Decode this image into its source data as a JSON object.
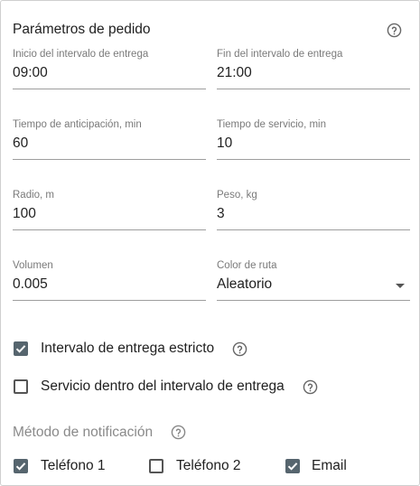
{
  "panel": {
    "title": "Parámetros de pedido",
    "help_icon": "help-circle-icon"
  },
  "fields": {
    "delivery_start": {
      "label": "Inicio del intervalo de entrega",
      "value": "09:00"
    },
    "delivery_end": {
      "label": "Fin del intervalo de entrega",
      "value": "21:00"
    },
    "lead_time": {
      "label": "Tiempo de anticipación, min",
      "value": "60"
    },
    "service_time": {
      "label": "Tiempo de servicio, min",
      "value": "10"
    },
    "radius": {
      "label": "Radio, m",
      "value": "100"
    },
    "weight": {
      "label": "Peso, kg",
      "value": "3"
    },
    "volume": {
      "label": "Volumen",
      "value": "0.005"
    },
    "route_color": {
      "label": "Color de ruta",
      "value": "Aleatorio"
    }
  },
  "options": {
    "strict_interval": {
      "label": "Intervalo de entrega estricto",
      "checked": true
    },
    "service_in_interval": {
      "label": "Servicio dentro del intervalo de entrega",
      "checked": false
    }
  },
  "notification": {
    "label": "Método de notificación",
    "phone1": {
      "label": "Teléfono 1",
      "checked": true
    },
    "phone2": {
      "label": "Teléfono 2",
      "checked": false
    },
    "email": {
      "label": "Email",
      "checked": true
    }
  },
  "colors": {
    "checkbox_checked": "#56656e",
    "underline": "#9e9e9e",
    "label_muted": "#7a7a7a"
  }
}
